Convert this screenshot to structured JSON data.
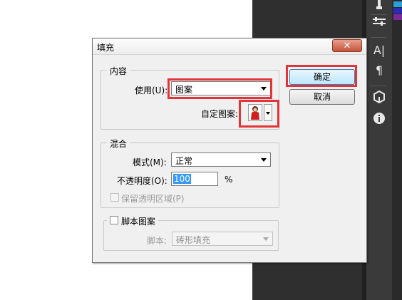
{
  "dialog": {
    "title": "填充",
    "close_glyph": "✕",
    "ok_label": "确定",
    "cancel_label": "取消"
  },
  "content_group": {
    "legend": "内容",
    "use_label": "使用(U):",
    "use_value": "图案",
    "custom_pattern_label": "自定图案:"
  },
  "blend_group": {
    "legend": "混合",
    "mode_label": "模式(M):",
    "mode_value": "正常",
    "opacity_label": "不透明度(O):",
    "opacity_value": "100",
    "opacity_unit": "%",
    "preserve_label": "保留透明区域(P)"
  },
  "script_group": {
    "legend": "脚本图案",
    "script_label": "脚本:",
    "script_value": "砖形填充"
  },
  "ps_panel": {
    "icons": [
      "brush-icon",
      "sliders-icon",
      "type-icon",
      "paragraph-icon",
      "3d-cube-icon",
      "info-icon"
    ],
    "text_icon_glyph": "A|",
    "paragraph_glyph": "¶",
    "info_glyph": "i"
  },
  "colors": {
    "highlight_red": "#e3343a",
    "selection_blue": "#3399ff"
  }
}
